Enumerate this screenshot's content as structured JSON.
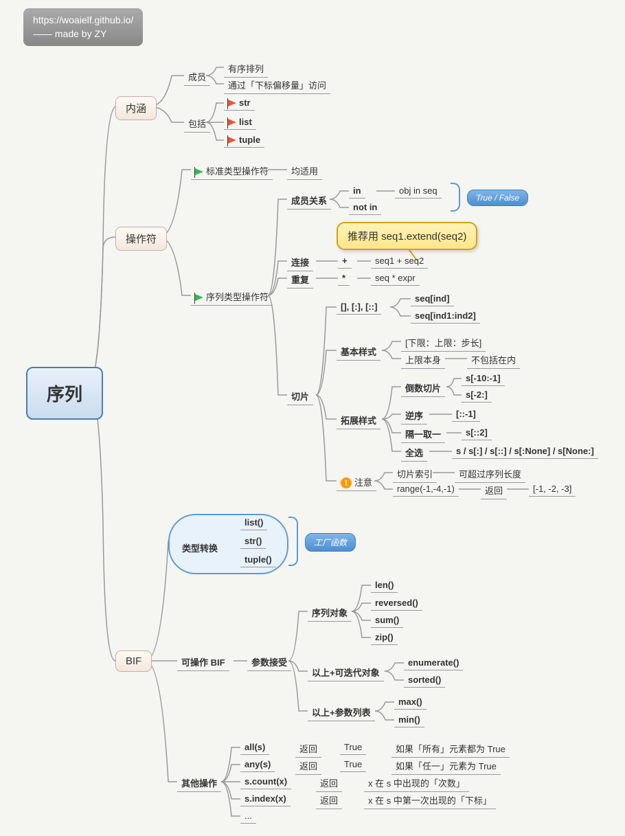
{
  "header": {
    "url": "https://woaielf.github.io/",
    "credit": "—— made by ZY"
  },
  "root": "序列",
  "branch1": {
    "label": "内涵",
    "members": {
      "label": "成员",
      "a": "有序排列",
      "b": "通过「下标偏移量」访问"
    },
    "includes": {
      "label": "包括",
      "str": "str",
      "list": "list",
      "tuple": "tuple"
    }
  },
  "branch2": {
    "label": "操作符",
    "std": {
      "label": "标准类型操作符",
      "note": "均适用"
    },
    "seq": {
      "label": "序列类型操作符",
      "member": {
        "label": "成员关系",
        "in": "in",
        "notin": "not in",
        "ex": "obj in seq",
        "badge": "True / False"
      },
      "callout": "推荐用 seq1.extend(seq2)",
      "concat": {
        "label": "连接",
        "op": "+",
        "ex": "seq1 + seq2"
      },
      "repeat": {
        "label": "重复",
        "op": "*",
        "ex": "seq * expr"
      },
      "slice": {
        "label": "切片",
        "bracket": {
          "label": "[], [:], [::]",
          "a": "seq[ind]",
          "b": "seq[ind1:ind2]"
        },
        "basic": {
          "label": "基本样式",
          "a": "[下限：上限：步长]",
          "b1": "上限本身",
          "b2": "不包括在内"
        },
        "ext": {
          "label": "拓展样式",
          "rev": {
            "label": "倒数切片",
            "a": "s[-10:-1]",
            "b": "s[-2:]"
          },
          "reverse": {
            "label": "逆序",
            "v": "[::-1]"
          },
          "every": {
            "label": "隔一取一",
            "v": "s[::2]"
          },
          "all": {
            "label": "全选",
            "v": "s / s[:] / s[::] / s[:None] / s[None:]"
          }
        },
        "note": {
          "label": "注意",
          "a1": "切片索引",
          "a2": "可超过序列长度",
          "b1": "range(-1,-4,-1)",
          "b2": "返回",
          "b3": "[-1, -2, -3]"
        }
      }
    }
  },
  "branch3": {
    "label": "BIF",
    "conv": {
      "label": "类型转换",
      "list": "list()",
      "str": "str()",
      "tuple": "tuple()",
      "badge": "工厂函数"
    },
    "op": {
      "label": "可操作 BIF",
      "param": "参数接受",
      "seq": {
        "label": "序列对象",
        "len": "len()",
        "rev": "reversed()",
        "sum": "sum()",
        "zip": "zip()"
      },
      "iter": {
        "label": "以上+可迭代对象",
        "enum": "enumerate()",
        "sort": "sorted()"
      },
      "args": {
        "label": "以上+参数列表",
        "max": "max()",
        "min": "min()"
      }
    },
    "other": {
      "label": "其他操作",
      "all": {
        "fn": "all(s)",
        "ret": "返回",
        "v": "True",
        "desc": "如果「所有」元素都为 True"
      },
      "any": {
        "fn": "any(s)",
        "ret": "返回",
        "v": "True",
        "desc": "如果「任一」元素为 True"
      },
      "count": {
        "fn": "s.count(x)",
        "ret": "返回",
        "desc": "x 在 s 中出现的「次数」"
      },
      "index": {
        "fn": "s.index(x)",
        "ret": "返回",
        "desc": "x 在 s 中第一次出现的「下标」"
      },
      "more": "..."
    }
  }
}
